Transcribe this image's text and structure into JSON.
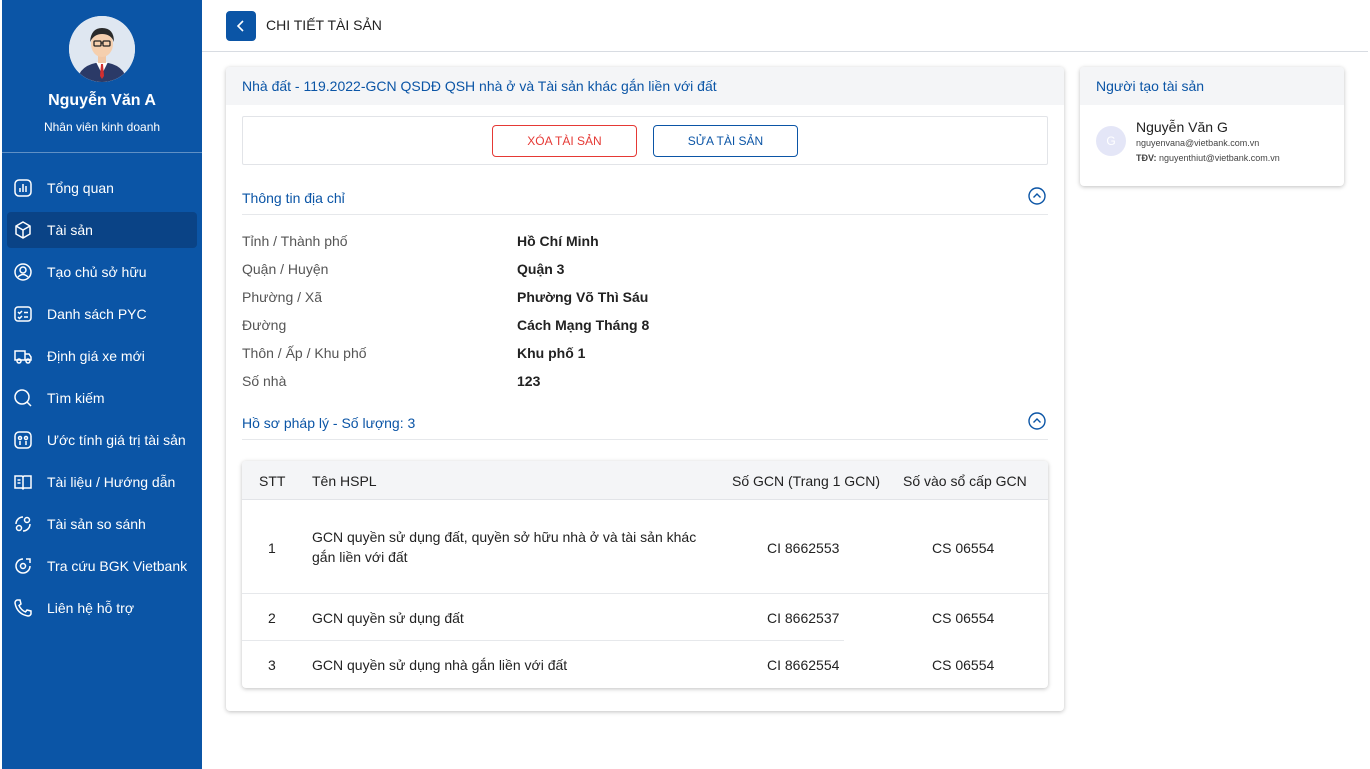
{
  "colors": {
    "primary": "#0b55a6",
    "danger": "#e53935",
    "sidebar_active": "#0a4386"
  },
  "profile": {
    "name": "Nguyễn Văn A",
    "role": "Nhân viên kinh doanh"
  },
  "sidebar": {
    "items": [
      {
        "label": "Tổng quan",
        "icon": "chart-icon"
      },
      {
        "label": "Tài sản",
        "icon": "box-icon",
        "active": true
      },
      {
        "label": "Tạo chủ sở hữu",
        "icon": "user-circle-icon"
      },
      {
        "label": "Danh sách PYC",
        "icon": "checklist-icon"
      },
      {
        "label": "Định giá xe mới",
        "icon": "car-icon"
      },
      {
        "label": "Tìm kiếm",
        "icon": "search-icon"
      },
      {
        "label": "Ước tính giá trị tài sản",
        "icon": "calculator-icon"
      },
      {
        "label": "Tài liệu / Hướng dẫn",
        "icon": "book-icon"
      },
      {
        "label": "Tài sản so sánh",
        "icon": "compare-icon"
      },
      {
        "label": "Tra cứu BGK Vietbank",
        "icon": "lookup-icon"
      },
      {
        "label": "Liên hệ hỗ trợ",
        "icon": "phone-icon"
      }
    ]
  },
  "header": {
    "title": "CHI TIẾT TÀI SẢN"
  },
  "asset": {
    "title": "Nhà đất - 119.2022-GCN QSDĐ QSH nhà ở và Tài sản khác gắn liền với đất",
    "delete_label": "XÓA TÀI SẢN",
    "edit_label": "SỬA TÀI SẢN"
  },
  "address": {
    "section_title": "Thông tin địa chỉ",
    "rows": [
      {
        "key": "Tỉnh / Thành phố",
        "value": "Hồ Chí Minh"
      },
      {
        "key": "Quận / Huyện",
        "value": "Quận 3"
      },
      {
        "key": "Phường / Xã",
        "value": "Phường Võ Thì Sáu"
      },
      {
        "key": "Đường",
        "value": "Cách Mạng Tháng 8"
      },
      {
        "key": "Thôn / Ấp / Khu phố",
        "value": "Khu phố 1"
      },
      {
        "key": "Số nhà",
        "value": "123"
      }
    ]
  },
  "legal": {
    "section_title": "Hồ sơ pháp lý - Số lượng: 3",
    "columns": [
      "STT",
      "Tên HSPL",
      "Số GCN (Trang 1 GCN)",
      "Số vào sổ cấp GCN"
    ],
    "rows": [
      {
        "stt": "1",
        "name_line1": "GCN quyền sử dụng đất, quyền sở hữu nhà ở và tài sản khác",
        "name_line2": "gắn liền với đất",
        "gcn": "CI 8662553",
        "so_vao_so": "CS 06554"
      },
      {
        "stt": "2",
        "name_line1": "GCN quyền sử dụng đất",
        "name_line2": "",
        "gcn": "CI 8662537",
        "so_vao_so": "CS 06554"
      },
      {
        "stt": "3",
        "name_line1": "GCN quyền sử dụng nhà gắn liền với đất",
        "name_line2": "",
        "gcn": "CI 8662554",
        "so_vao_so": "CS 06554"
      }
    ]
  },
  "creator": {
    "section_title": "Người tạo tài sản",
    "initial": "G",
    "name": "Nguyễn Văn G",
    "email": "nguyenvana@vietbank.com.vn",
    "tdv_label": "TĐV:",
    "tdv_email": "nguyenthiut@vietbank.com.vn"
  }
}
